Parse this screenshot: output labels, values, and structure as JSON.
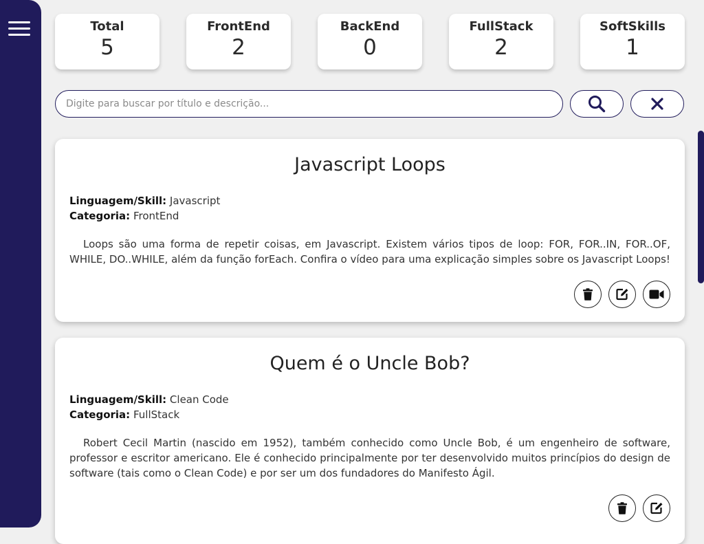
{
  "stats": [
    {
      "label": "Total",
      "value": "5"
    },
    {
      "label": "FrontEnd",
      "value": "2"
    },
    {
      "label": "BackEnd",
      "value": "0"
    },
    {
      "label": "FullStack",
      "value": "2"
    },
    {
      "label": "SoftSkills",
      "value": "1"
    }
  ],
  "search": {
    "placeholder": "Digite para buscar por título e descrição...",
    "value": ""
  },
  "labels": {
    "language": "Linguagem/Skill:",
    "category": "Categoria:"
  },
  "cards": [
    {
      "title": "Javascript Loops",
      "language": "Javascript",
      "category": "FrontEnd",
      "description": "Loops são uma forma de repetir coisas, em Javascript. Existem vários tipos de loop: FOR, FOR..IN, FOR..OF, WHILE, DO..WHILE, além da função forEach. Confira o vídeo para uma explicação simples sobre os Javascript Loops!",
      "actions": [
        "trash-icon",
        "edit-icon",
        "video-icon"
      ]
    },
    {
      "title": "Quem é o Uncle Bob?",
      "language": "Clean Code",
      "category": "FullStack",
      "description": "Robert Cecil Martin (nascido em 1952), também conhecido como Uncle Bob, é um engenheiro de software, professor e escritor americano. Ele é conhecido principalmente por ter desenvolvido muitos princípios do design de software (tais como o Clean Code) e por ser um dos fundadores do Manifesto Ágil.",
      "actions": [
        "trash-icon",
        "edit-icon"
      ]
    }
  ],
  "colors": {
    "primary": "#201b5b",
    "background": "#f0f0f0",
    "card": "#ffffff"
  }
}
